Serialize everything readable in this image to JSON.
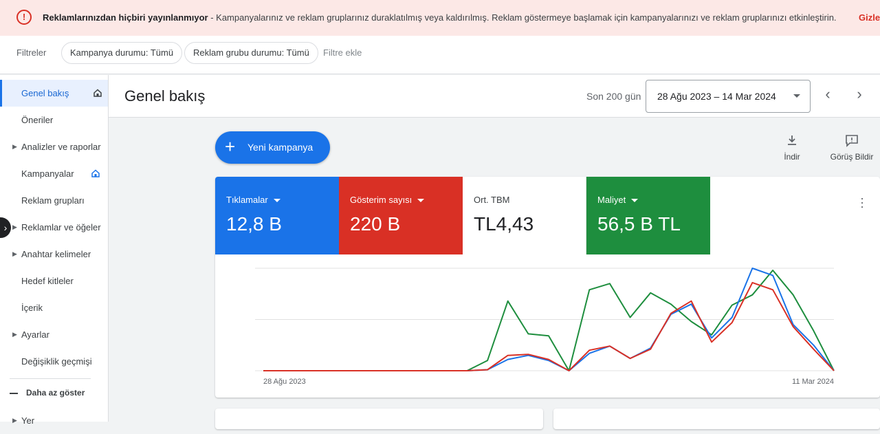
{
  "alert": {
    "bold": "Reklamlarınızdan hiçbiri yayınlanmıyor",
    "text": " - Kampanyalarınız ve reklam gruplarınız duraklatılmış veya kaldırılmış. Reklam göstermeye başlamak için kampanyalarınızı ve reklam gruplarınızı etkinleştirin.",
    "action": "Gizle"
  },
  "filters": {
    "label": "Filtreler",
    "chips": [
      "Kampanya durumu: Tümü",
      "Reklam grubu durumu: Tümü"
    ],
    "add": "Filtre ekle"
  },
  "sidebar": {
    "items": [
      {
        "label": "Genel bakış"
      },
      {
        "label": "Öneriler"
      },
      {
        "label": "Analizler ve raporlar"
      },
      {
        "label": "Kampanyalar"
      },
      {
        "label": "Reklam grupları"
      },
      {
        "label": "Reklamlar ve öğeler"
      },
      {
        "label": "Anahtar kelimeler"
      },
      {
        "label": "Hedef kitleler"
      },
      {
        "label": "İçerik"
      },
      {
        "label": "Ayarlar"
      },
      {
        "label": "Değişiklik geçmişi"
      }
    ],
    "show_less": "Daha az göster",
    "next": "Yer"
  },
  "header": {
    "title": "Genel bakış",
    "range_label": "Son 200 gün",
    "date_range": "28 Ağu 2023 – 14 Mar 2024"
  },
  "actions": {
    "new_campaign": "Yeni kampanya",
    "download": "İndir",
    "feedback": "Görüş Bildir"
  },
  "metrics": [
    {
      "label": "Tıklamalar",
      "value": "12,8 B",
      "color": "#1a73e8"
    },
    {
      "label": "Gösterim sayısı",
      "value": "220 B",
      "color": "#d93025"
    },
    {
      "label": "Ort. TBM",
      "value": "TL4,43",
      "color": "#ffffff"
    },
    {
      "label": "Maliyet",
      "value": "56,5 B TL",
      "color": "#1e8e3e"
    }
  ],
  "chart_data": {
    "type": "line",
    "x_start_label": "28 Ağu 2023",
    "x_end_label": "11 Mar 2024",
    "y_max": 100,
    "series": [
      {
        "name": "Tıklamalar",
        "color": "#1a73e8",
        "values": [
          0,
          0,
          0,
          0,
          0,
          0,
          0,
          0,
          0,
          0,
          0,
          1,
          11,
          15,
          10,
          0,
          17,
          24,
          12,
          22,
          55,
          65,
          32,
          52,
          100,
          93,
          45,
          25,
          0
        ]
      },
      {
        "name": "Gösterim sayısı",
        "color": "#d93025",
        "values": [
          0,
          0,
          0,
          0,
          0,
          0,
          0,
          0,
          0,
          0,
          0,
          1,
          15,
          16,
          11,
          0,
          20,
          24,
          12,
          21,
          56,
          68,
          28,
          47,
          86,
          79,
          43,
          21,
          0
        ]
      },
      {
        "name": "Maliyet",
        "color": "#1e8e3e",
        "values": [
          0,
          0,
          0,
          0,
          0,
          0,
          0,
          0,
          0,
          0,
          0,
          10,
          68,
          36,
          34,
          0,
          79,
          85,
          52,
          76,
          65,
          48,
          35,
          64,
          74,
          98,
          74,
          39,
          0
        ]
      }
    ]
  }
}
